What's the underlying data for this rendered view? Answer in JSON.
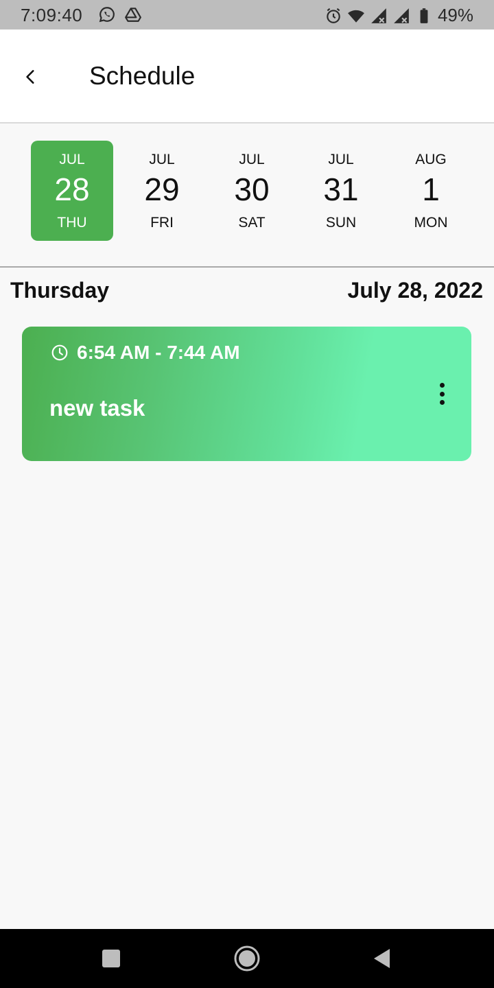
{
  "status_bar": {
    "time": "7:09:40",
    "battery": "49%",
    "left_icons": [
      "whatsapp-icon",
      "drive-icon"
    ],
    "right_icons": [
      "alarm-icon",
      "wifi-icon",
      "signal-icon",
      "signal-icon",
      "battery-icon"
    ]
  },
  "app_bar": {
    "title": "Schedule",
    "back_icon": "chevron-left-icon"
  },
  "date_strip": {
    "selected_index": 0,
    "selected_color": "#4caf50",
    "dates": [
      {
        "month": "JUL",
        "day": "28",
        "weekday": "THU"
      },
      {
        "month": "JUL",
        "day": "29",
        "weekday": "FRI"
      },
      {
        "month": "JUL",
        "day": "30",
        "weekday": "SAT"
      },
      {
        "month": "JUL",
        "day": "31",
        "weekday": "SUN"
      },
      {
        "month": "AUG",
        "day": "1",
        "weekday": "MON"
      }
    ]
  },
  "day_header": {
    "weekday": "Thursday",
    "date": "July 28, 2022"
  },
  "tasks": [
    {
      "time": "6:54 AM - 7:44 AM",
      "title": "new task",
      "gradient_start": "#4caf50",
      "gradient_end": "#6af0ae"
    }
  ],
  "nav_bar": {
    "buttons": [
      "recents-icon",
      "home-icon",
      "back-icon"
    ]
  }
}
